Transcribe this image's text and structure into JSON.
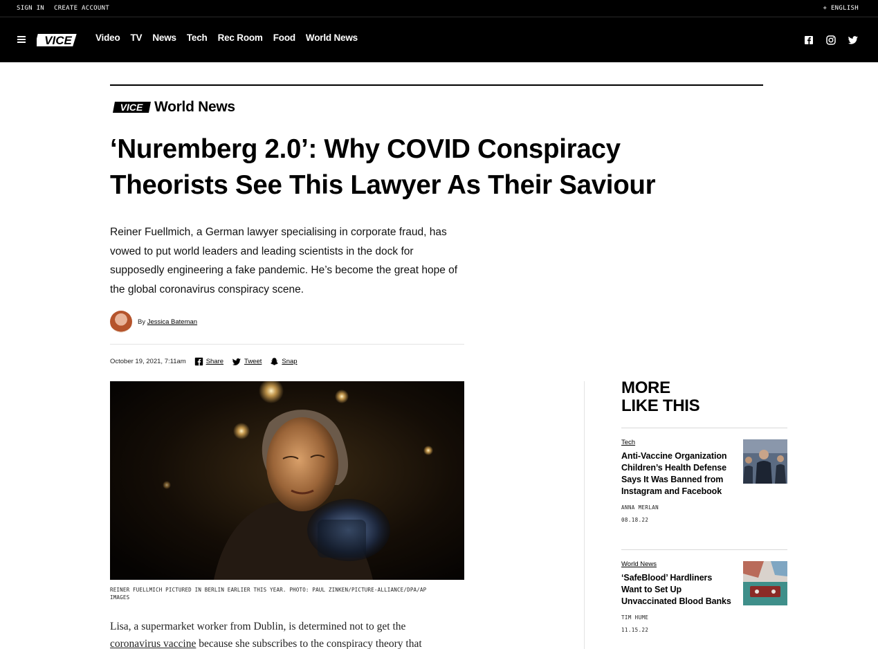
{
  "utility": {
    "sign_in": "SIGN IN",
    "create_account": "CREATE ACCOUNT",
    "language": "+ ENGLISH"
  },
  "brand": {
    "logo_text": "VICE",
    "section": "World News"
  },
  "nav": {
    "items": [
      "Video",
      "TV",
      "News",
      "Tech",
      "Rec Room",
      "Food",
      "World News"
    ]
  },
  "social": [
    "facebook-icon",
    "instagram-icon",
    "twitter-icon"
  ],
  "article": {
    "headline_line1": "‘Nuremberg 2.0’: Why COVID Conspiracy",
    "headline_line2": "Theorists See This Lawyer As Their Saviour",
    "dek": "Reiner Fuellmich, a German lawyer specialising in corporate fraud, has vowed to put world leaders and leading scientists in the dock for supposedly engineering a fake pandemic. He’s become the great hope of the global coronavirus conspiracy scene.",
    "byline_prefix": "By",
    "author": "Jessica Bateman",
    "date": "October 19, 2021, 7:11am",
    "share": {
      "facebook": "Share",
      "twitter": "Tweet",
      "snapchat": "Snap"
    },
    "caption": "REINER FUELLMICH PICTURED IN BERLIN EARLIER THIS YEAR. PHOTO: PAUL ZINKEN/PICTURE-ALLIANCE/DPA/AP IMAGES",
    "body_start": "Lisa, a supermarket worker from Dublin, is determined not to get the",
    "body_link": "coronavirus vaccine",
    "body_end": " because she subscribes to the conspiracy theory that"
  },
  "sidebar": {
    "title_line1": "MORE",
    "title_line2": "LIKE THIS",
    "cards": [
      {
        "category": "Tech",
        "title": "Anti-Vaccine Organization Children’s Health Defense Says It Was Banned from Instagram and Facebook",
        "author": "ANNA MERLAN",
        "date": "08.18.22"
      },
      {
        "category": "World News",
        "title": "‘SafeBlood’ Hardliners Want to Set Up Unvaccinated Blood Banks",
        "author": "TIM HUME",
        "date": "11.15.22"
      }
    ]
  },
  "colors": {
    "nav_bg": "#000000",
    "text": "#000000",
    "rule": "#e3e3e3"
  }
}
